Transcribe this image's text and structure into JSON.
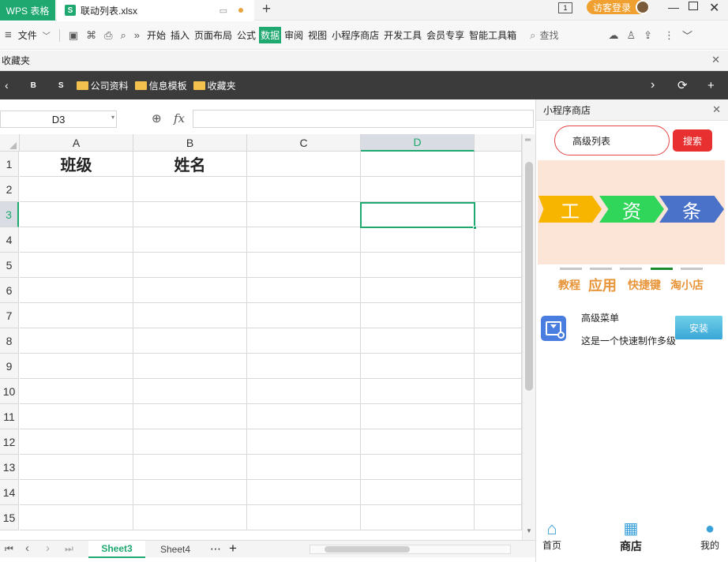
{
  "titlebar": {
    "app_name": "WPS 表格",
    "file_name": "联动列表.xlsx",
    "new_tab": "+",
    "login_label": "访客登录"
  },
  "menubar": {
    "file_label": "文件",
    "more": "»",
    "items": [
      "开始",
      "插入",
      "页面布局",
      "公式",
      "数据",
      "审阅",
      "视图",
      "小程序商店",
      "开发工具",
      "会员专享",
      "智能工具箱"
    ],
    "active_index": 4,
    "search_label": "查找"
  },
  "favbar": {
    "label": "收藏夹"
  },
  "bookbar": {
    "items": [
      "B",
      "S"
    ],
    "folders": [
      "公司资料",
      "信息模板",
      "收藏夹"
    ]
  },
  "formulabar": {
    "name_box": "D3",
    "fx": "fx"
  },
  "grid": {
    "columns": [
      "A",
      "B",
      "C",
      "D"
    ],
    "selected_column": "D",
    "rows": [
      "1",
      "2",
      "3",
      "4",
      "5",
      "6",
      "7",
      "8",
      "9",
      "10",
      "11",
      "12",
      "13",
      "14",
      "15"
    ],
    "selected_row": "3",
    "cells": {
      "A1": "班级",
      "B1": "姓名"
    }
  },
  "sheets": {
    "tabs": [
      "Sheet3",
      "Sheet4"
    ],
    "active": "Sheet3",
    "more": "⋯",
    "add": "+"
  },
  "panel": {
    "title": "小程序商店",
    "search_value": "高级列表",
    "search_button": "搜索",
    "banner_words": [
      "工",
      "资",
      "条"
    ],
    "banner_colors": [
      "#f7b500",
      "#2fd65a",
      "#4a72c9"
    ],
    "active_indicator": 3,
    "categories": [
      "教程",
      "应用",
      "快捷键",
      "淘小店"
    ],
    "app": {
      "name": "高级菜单",
      "description": "这是一个快速制作多级",
      "install": "安装"
    },
    "bottom_tabs": [
      "首页",
      "商店",
      "我的"
    ]
  }
}
